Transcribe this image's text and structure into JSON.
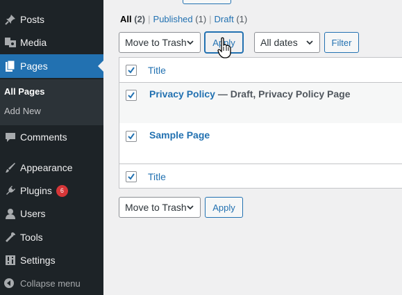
{
  "sidebar": {
    "items": [
      {
        "label": "Posts",
        "icon": "pushpin-icon"
      },
      {
        "label": "Media",
        "icon": "media-icon"
      },
      {
        "label": "Pages",
        "icon": "pages-icon"
      },
      {
        "label": "Comments",
        "icon": "comment-icon"
      },
      {
        "label": "Appearance",
        "icon": "brush-icon"
      },
      {
        "label": "Plugins",
        "icon": "plug-icon",
        "badge": "6"
      },
      {
        "label": "Users",
        "icon": "user-icon"
      },
      {
        "label": "Tools",
        "icon": "wrench-icon"
      },
      {
        "label": "Settings",
        "icon": "settings-icon"
      }
    ],
    "submenu": {
      "all_pages": "All Pages",
      "add_new": "Add New"
    },
    "collapse": "Collapse menu"
  },
  "filters": {
    "all": "All",
    "all_count": "(2)",
    "published": "Published",
    "published_count": "(1)",
    "draft": "Draft",
    "draft_count": "(1)",
    "separator": "|"
  },
  "bulk": {
    "action_top": "Move to Trash",
    "apply_top": "Apply",
    "dates": "All dates",
    "filter": "Filter",
    "action_bottom": "Move to Trash",
    "apply_bottom": "Apply"
  },
  "table": {
    "header_title": "Title",
    "footer_title": "Title",
    "rows": [
      {
        "title": "Privacy Policy",
        "state": " — Draft, Privacy Policy Page",
        "checked": true
      },
      {
        "title": "Sample Page",
        "state": "",
        "checked": true
      }
    ]
  },
  "colors": {
    "sidebar_bg": "#1d2327",
    "accent": "#2271b1",
    "badge": "#d63638"
  }
}
